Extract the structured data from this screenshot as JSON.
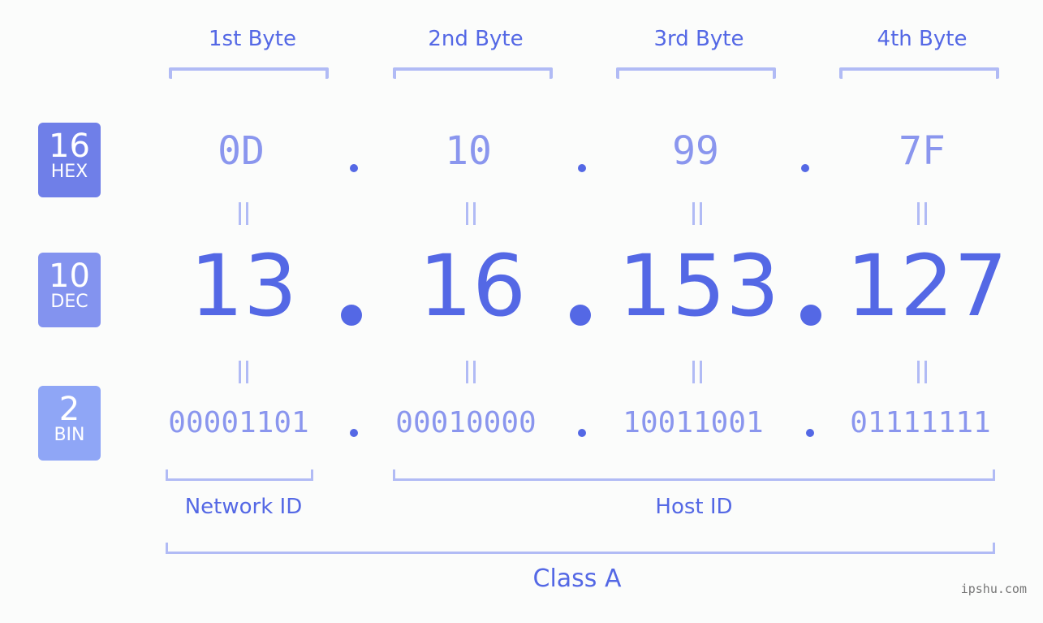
{
  "bytes": [
    {
      "label": "1st Byte",
      "hex": "0D",
      "dec": "13",
      "bin": "00001101"
    },
    {
      "label": "2nd Byte",
      "hex": "10",
      "dec": "16",
      "bin": "00010000"
    },
    {
      "label": "3rd Byte",
      "hex": "99",
      "dec": "153",
      "bin": "10011001"
    },
    {
      "label": "4th Byte",
      "hex": "7F",
      "dec": "127",
      "bin": "01111111"
    }
  ],
  "badges": {
    "hex": {
      "num": "16",
      "label": "HEX",
      "color": "#6f7fe8"
    },
    "dec": {
      "num": "10",
      "label": "DEC",
      "color": "#8393ef"
    },
    "bin": {
      "num": "2",
      "label": "BIN",
      "color": "#8fa6f6"
    }
  },
  "sections": {
    "network": "Network ID",
    "host": "Host ID",
    "class": "Class A"
  },
  "watermark": "ipshu.com",
  "colors": {
    "accent": "#5468e5",
    "light": "#8a96ee",
    "bracket": "#b1bbf5"
  }
}
